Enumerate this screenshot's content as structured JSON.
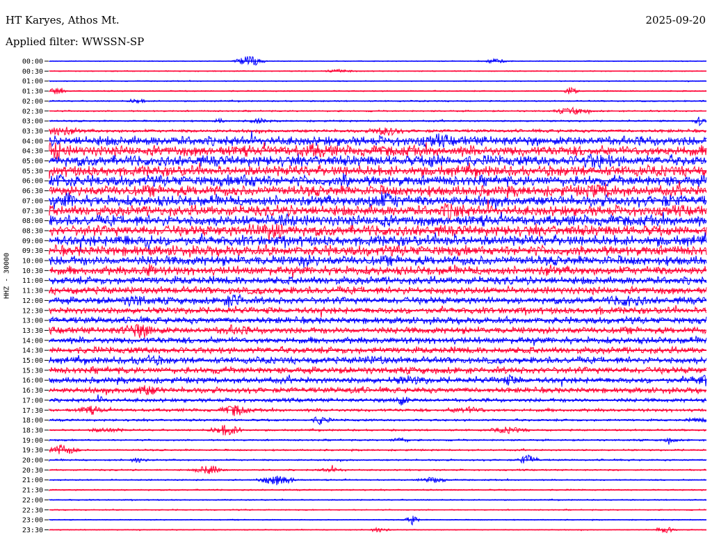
{
  "header": {
    "station": "HT Karyes, Athos Mt.",
    "date": "2025-09-20",
    "filter_label": "Applied filter: WWSSN-SP"
  },
  "colors": {
    "trace_a": "#0000ff",
    "trace_b": "#ff0033",
    "background": "#ffffff"
  },
  "chart_data": {
    "type": "line",
    "title": "HT Karyes, Athos Mt.",
    "ylabel": "HHZ - 30000",
    "rows": [
      "00:00",
      "00:30",
      "01:00",
      "01:30",
      "02:00",
      "02:30",
      "03:00",
      "03:30",
      "04:00",
      "04:30",
      "05:00",
      "05:30",
      "06:00",
      "06:30",
      "07:00",
      "07:30",
      "08:00",
      "08:30",
      "09:00",
      "09:30",
      "10:00",
      "10:30",
      "11:00",
      "11:30",
      "12:00",
      "12:30",
      "13:00",
      "13:30",
      "14:00",
      "14:30",
      "15:00",
      "15:30",
      "16:00",
      "16:30",
      "17:00",
      "17:30",
      "18:00",
      "18:30",
      "19:00",
      "19:30",
      "20:00",
      "20:30",
      "21:00",
      "21:30",
      "22:00",
      "22:30",
      "23:00",
      "23:30"
    ],
    "row_noise_level": [
      0.5,
      0.6,
      0.6,
      0.7,
      0.8,
      0.9,
      1.0,
      1.8,
      5.5,
      6.0,
      6.0,
      6.0,
      6.0,
      6.0,
      6.0,
      6.0,
      6.0,
      6.0,
      6.0,
      5.8,
      5.5,
      5.0,
      4.5,
      4.2,
      4.0,
      3.8,
      3.8,
      3.8,
      3.8,
      3.8,
      3.8,
      3.8,
      3.5,
      3.2,
      2.2,
      1.8,
      1.3,
      1.1,
      1.0,
      1.0,
      1.0,
      0.9,
      0.8,
      0.8,
      0.7,
      0.7,
      0.6,
      0.6
    ],
    "alternating_colors": [
      "#0000ff",
      "#ff0033"
    ],
    "minutes_per_row": 30,
    "grid": false
  }
}
